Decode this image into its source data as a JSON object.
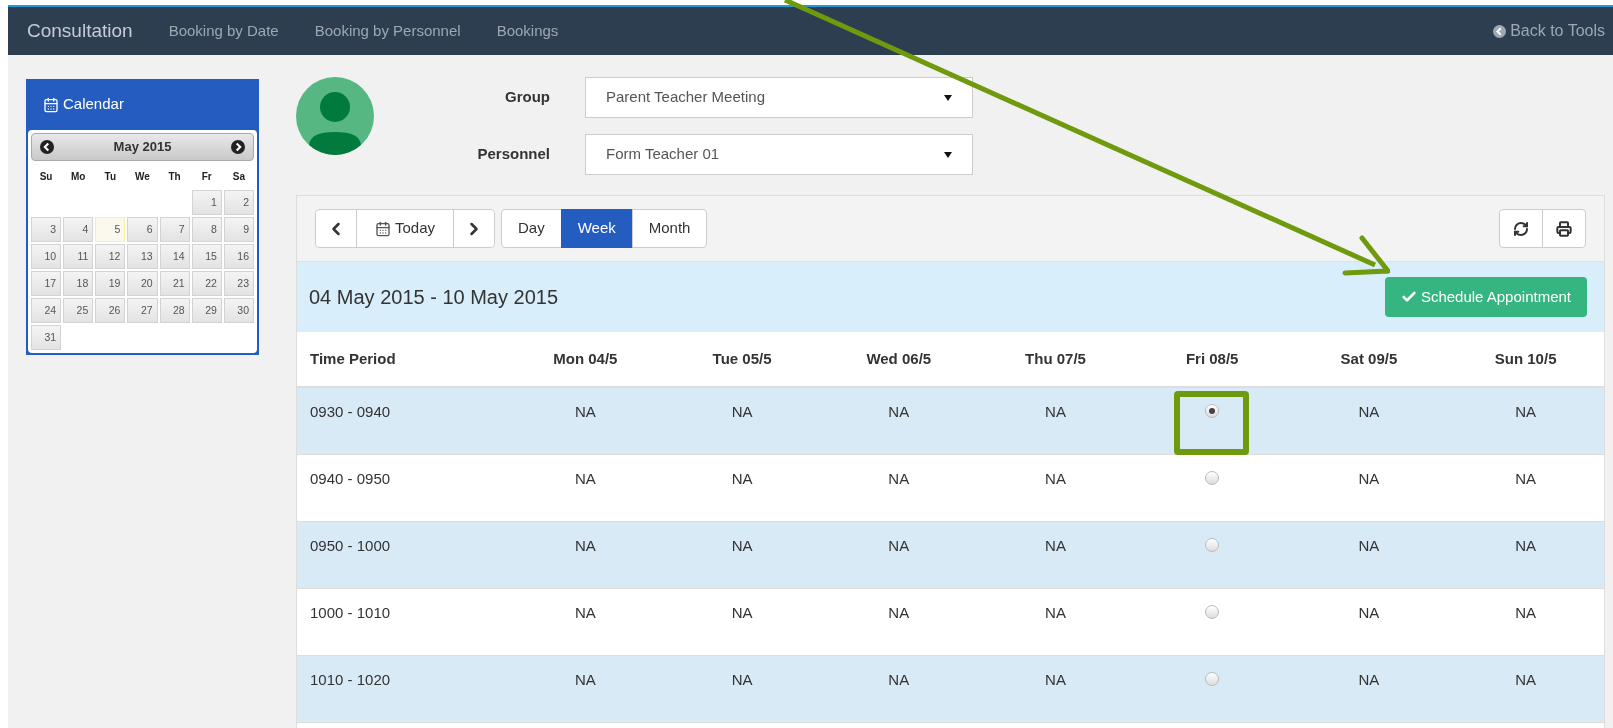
{
  "navbar": {
    "brand": "Consultation",
    "links": [
      "Booking by Date",
      "Booking by Personnel",
      "Bookings"
    ],
    "back": "Back to Tools"
  },
  "calendar": {
    "title": "Calendar",
    "month": "May 2015",
    "weekdays": [
      "Su",
      "Mo",
      "Tu",
      "We",
      "Th",
      "Fr",
      "Sa"
    ],
    "weeks": [
      [
        {
          "day": "1",
          "today": false
        },
        {
          "day": "2",
          "today": false
        }
      ],
      [
        {
          "day": "3",
          "today": false
        },
        {
          "day": "4",
          "today": false
        },
        {
          "day": "5",
          "today": true
        },
        {
          "day": "6",
          "today": false
        },
        {
          "day": "7",
          "today": false
        },
        {
          "day": "8",
          "today": false
        },
        {
          "day": "9",
          "today": false
        }
      ],
      [
        {
          "day": "10",
          "today": false
        },
        {
          "day": "11",
          "today": false
        },
        {
          "day": "12",
          "today": false
        },
        {
          "day": "13",
          "today": false
        },
        {
          "day": "14",
          "today": false
        },
        {
          "day": "15",
          "today": false
        },
        {
          "day": "16",
          "today": false
        }
      ],
      [
        {
          "day": "17",
          "today": false
        },
        {
          "day": "18",
          "today": false
        },
        {
          "day": "19",
          "today": false
        },
        {
          "day": "20",
          "today": false
        },
        {
          "day": "21",
          "today": false
        },
        {
          "day": "22",
          "today": false
        },
        {
          "day": "23",
          "today": false
        }
      ],
      [
        {
          "day": "24",
          "today": false
        },
        {
          "day": "25",
          "today": false
        },
        {
          "day": "26",
          "today": false
        },
        {
          "day": "27",
          "today": false
        },
        {
          "day": "28",
          "today": false
        },
        {
          "day": "29",
          "today": false
        },
        {
          "day": "30",
          "today": false
        }
      ],
      [
        {
          "day": "31",
          "today": false
        }
      ]
    ]
  },
  "filters": [
    {
      "label": "Group",
      "value": "Parent Teacher Meeting"
    },
    {
      "label": "Personnel",
      "value": "Form Teacher 01"
    }
  ],
  "toolbar": {
    "today": "Today",
    "views": [
      {
        "label": "Day",
        "selected": false
      },
      {
        "label": "Week",
        "selected": true
      },
      {
        "label": "Month",
        "selected": false
      }
    ]
  },
  "range": "04 May 2015 - 10 May 2015",
  "schedule_button": "Schedule Appointment",
  "table": {
    "columns": [
      "Time Period",
      "Mon 04/5",
      "Tue 05/5",
      "Wed 06/5",
      "Thu 07/5",
      "Fri 08/5",
      "Sat 09/5",
      "Sun 10/5"
    ],
    "rows": [
      {
        "cells": [
          {
            "kind": "time",
            "text": "0930 - 0940"
          },
          {
            "kind": "text",
            "text": "NA"
          },
          {
            "kind": "text",
            "text": "NA"
          },
          {
            "kind": "text",
            "text": "NA"
          },
          {
            "kind": "text",
            "text": "NA"
          },
          {
            "kind": "radio",
            "selected": true
          },
          {
            "kind": "text",
            "text": "NA"
          },
          {
            "kind": "text",
            "text": "NA"
          }
        ]
      },
      {
        "cells": [
          {
            "kind": "time",
            "text": "0940 - 0950"
          },
          {
            "kind": "text",
            "text": "NA"
          },
          {
            "kind": "text",
            "text": "NA"
          },
          {
            "kind": "text",
            "text": "NA"
          },
          {
            "kind": "text",
            "text": "NA"
          },
          {
            "kind": "radio",
            "selected": false
          },
          {
            "kind": "text",
            "text": "NA"
          },
          {
            "kind": "text",
            "text": "NA"
          }
        ]
      },
      {
        "cells": [
          {
            "kind": "time",
            "text": "0950 - 1000"
          },
          {
            "kind": "text",
            "text": "NA"
          },
          {
            "kind": "text",
            "text": "NA"
          },
          {
            "kind": "text",
            "text": "NA"
          },
          {
            "kind": "text",
            "text": "NA"
          },
          {
            "kind": "radio",
            "selected": false
          },
          {
            "kind": "text",
            "text": "NA"
          },
          {
            "kind": "text",
            "text": "NA"
          }
        ]
      },
      {
        "cells": [
          {
            "kind": "time",
            "text": "1000 - 1010"
          },
          {
            "kind": "text",
            "text": "NA"
          },
          {
            "kind": "text",
            "text": "NA"
          },
          {
            "kind": "text",
            "text": "NA"
          },
          {
            "kind": "text",
            "text": "NA"
          },
          {
            "kind": "radio",
            "selected": false
          },
          {
            "kind": "text",
            "text": "NA"
          },
          {
            "kind": "text",
            "text": "NA"
          }
        ]
      },
      {
        "cells": [
          {
            "kind": "time",
            "text": "1010 - 1020"
          },
          {
            "kind": "text",
            "text": "NA"
          },
          {
            "kind": "text",
            "text": "NA"
          },
          {
            "kind": "text",
            "text": "NA"
          },
          {
            "kind": "text",
            "text": "NA"
          },
          {
            "kind": "radio",
            "selected": false
          },
          {
            "kind": "text",
            "text": "NA"
          },
          {
            "kind": "text",
            "text": "NA"
          }
        ]
      }
    ]
  }
}
